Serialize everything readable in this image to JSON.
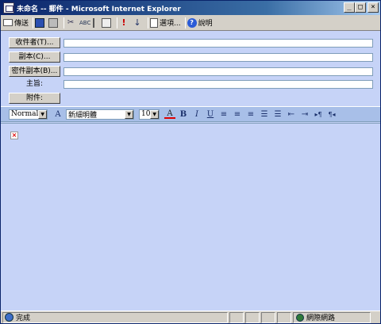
{
  "window": {
    "title": "未命名 -- 郵件 - Microsoft Internet Explorer",
    "buttons": {
      "minimize": "_",
      "maximize": "□",
      "close": "×"
    }
  },
  "toolbar": {
    "send_label": "傳送",
    "options_label": "選項...",
    "help_label": "說明"
  },
  "header": {
    "to_label": "收件者(T)...",
    "cc_label": "副本(C)...",
    "bcc_label": "密件副本(B)...",
    "subject_label": "主旨:",
    "attach_label": "附件:"
  },
  "format": {
    "style_value": "Normal",
    "font_value": "新細明體",
    "size_value": "10",
    "bold": "B",
    "italic": "I",
    "underline": "U",
    "font_icon": "A",
    "color_icon": "A",
    "ltr_icon": "▸¶",
    "rtl_icon": "¶◂"
  },
  "editor": {
    "broken_image": "×"
  },
  "status": {
    "text": "完成",
    "zone": "網際網路"
  }
}
